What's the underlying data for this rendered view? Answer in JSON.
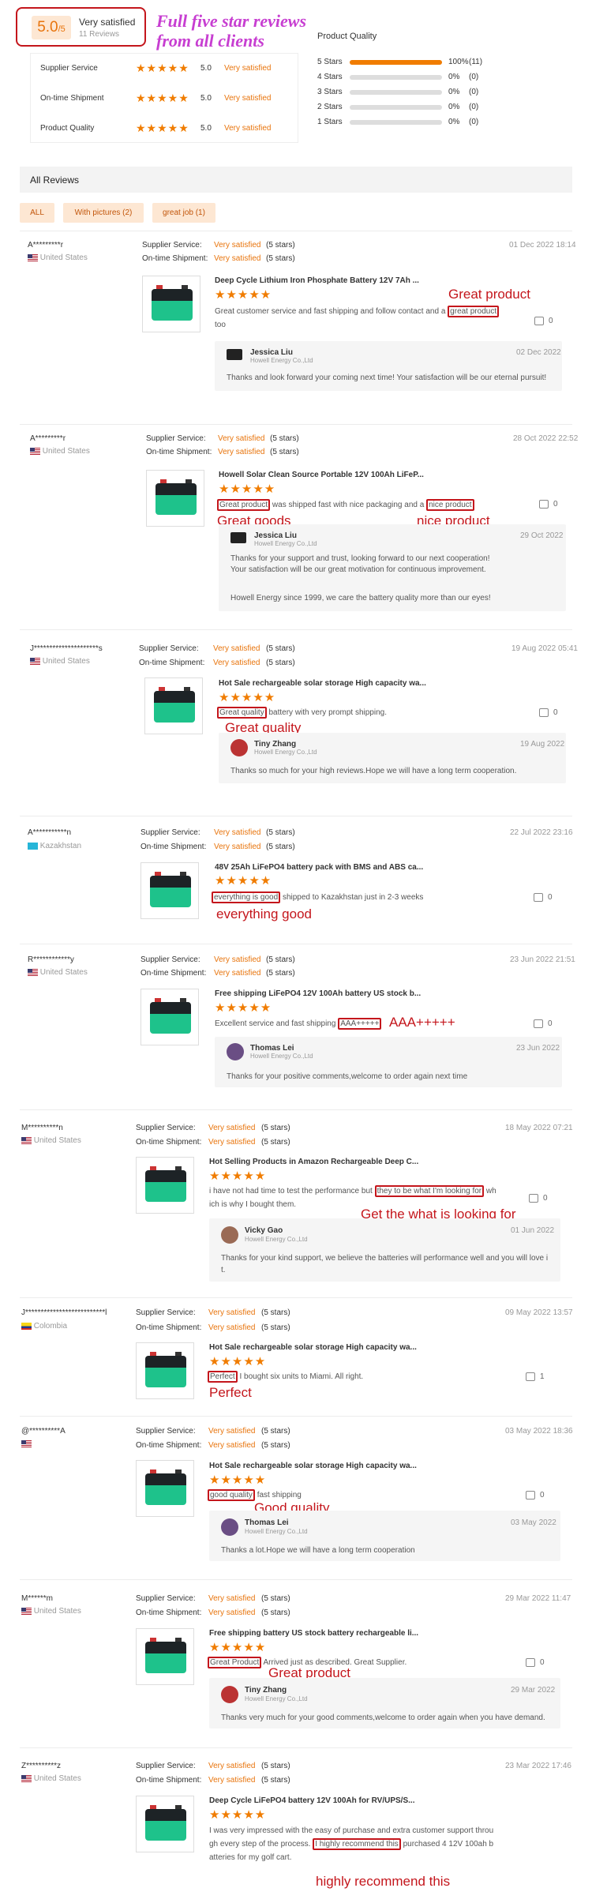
{
  "summary": {
    "score": "5.0",
    "score_suffix": "/5",
    "satisfaction": "Very satisfied",
    "reviews_count": "11 Reviews",
    "annotation_line1": "Full five star reviews",
    "annotation_line2": "from all clients",
    "ratings": [
      {
        "label": "Supplier Service",
        "value": "5.0",
        "text": "Very satisfied"
      },
      {
        "label": "On-time Shipment",
        "value": "5.0",
        "text": "Very satisfied"
      },
      {
        "label": "Product Quality",
        "value": "5.0",
        "text": "Very satisfied"
      }
    ]
  },
  "quality": {
    "title": "Product Quality",
    "rows": [
      {
        "label": "5 Stars",
        "percent": "100%",
        "count": "(11)",
        "fill": 1.0
      },
      {
        "label": "4 Stars",
        "percent": "0%",
        "count": "(0)",
        "fill": 0
      },
      {
        "label": "3 Stars",
        "percent": "0%",
        "count": "(0)",
        "fill": 0
      },
      {
        "label": "2 Stars",
        "percent": "0%",
        "count": "(0)",
        "fill": 0
      },
      {
        "label": "1 Stars",
        "percent": "0%",
        "count": "(0)",
        "fill": 0
      }
    ]
  },
  "all_reviews": {
    "title": "All Reviews",
    "filters": [
      "ALL",
      "With pictures (2)",
      "great job (1)"
    ]
  },
  "labels": {
    "supplier_service": "Supplier Service:",
    "ontime_shipment": "On-time Shipment:",
    "very_satisfied": "Very satisfied",
    "five_stars": "(5 stars)"
  },
  "reviews": [
    {
      "user": "A*********r",
      "country": "United States",
      "date": "01 Dec 2022 18:14",
      "product": "Deep Cycle Lithium Iron Phosphate Battery 12V 7Ah ...",
      "text_a": "Great customer service and fast shipping and follow contact and a ",
      "highlight": "great product",
      "text_b": "",
      "text_c": "too",
      "likes": "0",
      "note": "Great product",
      "reply_name": "Jessica Liu",
      "reply_company": "Howell Energy Co.,Ltd",
      "reply_date": "02 Dec 2022",
      "reply_text": "Thanks and look forward your coming next time! Your satisfaction will be our eternal pursuit!"
    },
    {
      "user": "A*********r",
      "country": "United States",
      "date": "28 Oct 2022 22:52",
      "product": "Howell Solar Clean Source Portable 12V 100Ah LiFeP...",
      "text_a": "",
      "highlight": "Great product",
      "text_b": " was shipped fast with nice packaging and a ",
      "highlight2": "nice product",
      "likes": "0",
      "note": "Great goods",
      "note2": "nice product",
      "reply_name": "Jessica Liu",
      "reply_company": "Howell Energy Co.,Ltd",
      "reply_date": "29 Oct 2022",
      "reply_text": "Thanks for your support and trust, looking forward to our next cooperation!",
      "reply_text2": "Your satisfaction will be our great motivation for continuous improvement.",
      "reply_text3": "Howell Energy since 1999, we care the battery quality more than our eyes!"
    },
    {
      "user": "J*********************s",
      "country": "United States",
      "date": "19 Aug 2022 05:41",
      "product": "Hot Sale rechargeable solar storage High capacity wa...",
      "highlight": "Great quality",
      "text_b": " battery with very prompt shipping.",
      "likes": "0",
      "note": "Great quality",
      "reply_name": "Tiny Zhang",
      "reply_company": "Howell Energy Co.,Ltd",
      "reply_date": "19 Aug 2022",
      "reply_text": "Thanks so much for your high reviews.Hope we will have a long term cooperation."
    },
    {
      "user": "A***********n",
      "country": "Kazakhstan",
      "date": "22 Jul 2022 23:16",
      "product": "48V 25Ah LiFePO4 battery pack with BMS and ABS ca...",
      "highlight": "everything is good",
      "text_b": " shipped to Kazakhstan just in 2-3 weeks",
      "likes": "0",
      "note": "everything good"
    },
    {
      "user": "R************y",
      "country": "United States",
      "date": "23 Jun 2022 21:51",
      "product": "Free shipping LiFePO4 12V 100Ah battery US stock b...",
      "text_a": "Excellent service and fast shipping ",
      "highlight": "AAA+++++",
      "likes": "0",
      "note": "AAA+++++",
      "reply_name": "Thomas Lei",
      "reply_company": "Howell Energy Co.,Ltd",
      "reply_date": "23 Jun 2022",
      "reply_text": "Thanks for your positive comments,welcome to order again next time"
    },
    {
      "user": "M**********n",
      "country": "United States",
      "date": "18 May 2022 07:21",
      "product": "Hot Selling Products in Amazon Rechargeable Deep C...",
      "text_a": "i have not had time to test the performance but ",
      "highlight": "they to be what I'm looking for",
      "text_b": " wh",
      "text_c": "ich is why I bought them.",
      "likes": "0",
      "note": "Get the what is looking for",
      "reply_name": "Vicky Gao",
      "reply_company": "Howell Energy Co.,Ltd",
      "reply_date": "01 Jun 2022",
      "reply_text": "Thanks for your kind support, we believe the batteries will performance well and you will love i",
      "reply_text2": "t."
    },
    {
      "user": "J**************************l",
      "country": "Colombia",
      "date": "09 May 2022 13:57",
      "product": "Hot Sale rechargeable solar storage High capacity wa...",
      "highlight": "Perfect",
      "text_b": " I bought six units to Miami. All right.",
      "likes": "1",
      "note": "Perfect"
    },
    {
      "user": "@**********A",
      "country": "",
      "date": "03 May 2022 18:36",
      "product": "Hot Sale rechargeable solar storage High capacity wa...",
      "highlight": "good quality",
      "text_b": " fast shipping",
      "likes": "0",
      "note": "Good quality",
      "reply_name": "Thomas Lei",
      "reply_company": "Howell Energy Co.,Ltd",
      "reply_date": "03 May 2022",
      "reply_text": "Thanks a lot.Hope we will have a long term cooperation"
    },
    {
      "user": "M******m",
      "country": "United States",
      "date": "29 Mar 2022 11:47",
      "product": "Free shipping battery US stock battery rechargeable li...",
      "highlight": "Great Product",
      "text_b": " Arrived just as described. Great Supplier.",
      "likes": "0",
      "note": "Great product",
      "reply_name": "Tiny Zhang",
      "reply_company": "Howell Energy Co.,Ltd",
      "reply_date": "29 Mar 2022",
      "reply_text": "Thanks very much for your good comments,welcome to order again when you have demand."
    },
    {
      "user": "Z**********z",
      "country": "United States",
      "date": "23 Mar 2022 17:46",
      "product": "Deep Cycle LiFePO4 battery 12V 100Ah for RV/UPS/S...",
      "text_a": "I was very impressed with the easy of purchase and extra customer support throu",
      "text_c": "gh every step of the process. ",
      "highlight": "I highly recommend this",
      "text_b": " purchased 4 12V 100ah b",
      "text_d": "atteries for my golf cart.",
      "note": "highly recommend this"
    }
  ]
}
